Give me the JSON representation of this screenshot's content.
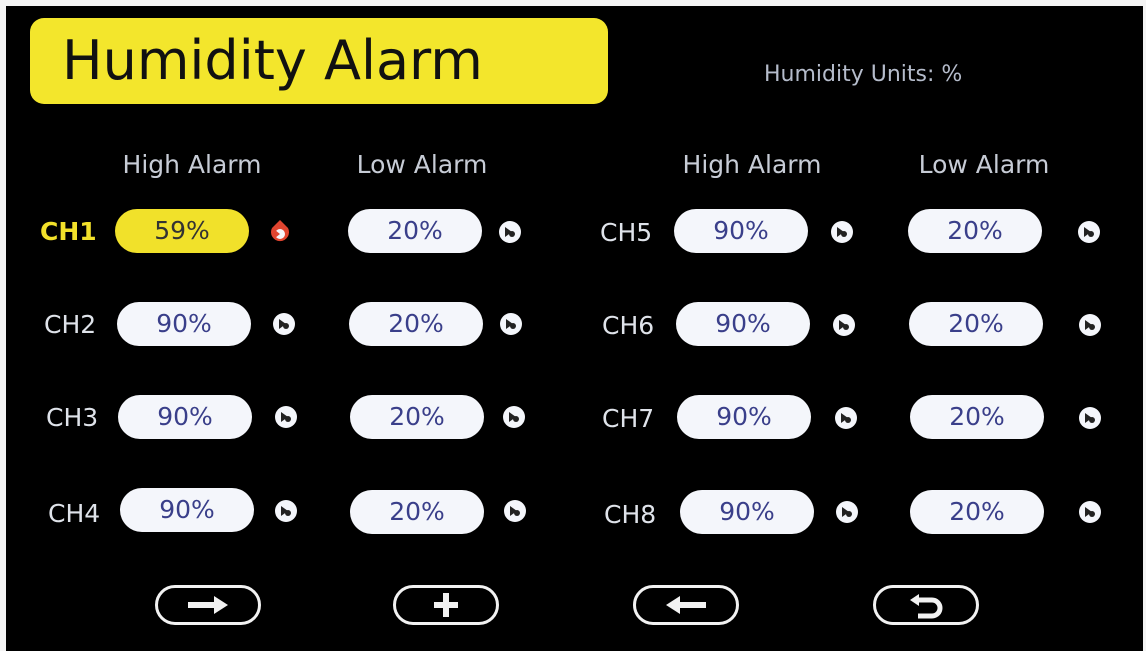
{
  "title": "Humidity Alarm",
  "units_text": "Humidity Units: %",
  "headers": [
    "High Alarm",
    "Low Alarm",
    "High Alarm",
    "Low Alarm"
  ],
  "channels": [
    {
      "label": "CH1",
      "high": "59%",
      "low": "20%",
      "active": true
    },
    {
      "label": "CH2",
      "high": "90%",
      "low": "20%"
    },
    {
      "label": "CH3",
      "high": "90%",
      "low": "20%"
    },
    {
      "label": "CH4",
      "high": "90%",
      "low": "20%"
    },
    {
      "label": "CH5",
      "high": "90%",
      "low": "20%"
    },
    {
      "label": "CH6",
      "high": "90%",
      "low": "20%"
    },
    {
      "label": "CH7",
      "high": "90%",
      "low": "20%"
    },
    {
      "label": "CH8",
      "high": "90%",
      "low": "20%"
    }
  ],
  "colors": {
    "accent": "#f3e62c",
    "alarm_icon_active": "#e0442f",
    "alarm_icon": "#f4f6fb"
  },
  "nav_buttons": [
    "right-arrow-icon",
    "plus-icon",
    "left-arrow-icon",
    "return-icon"
  ]
}
